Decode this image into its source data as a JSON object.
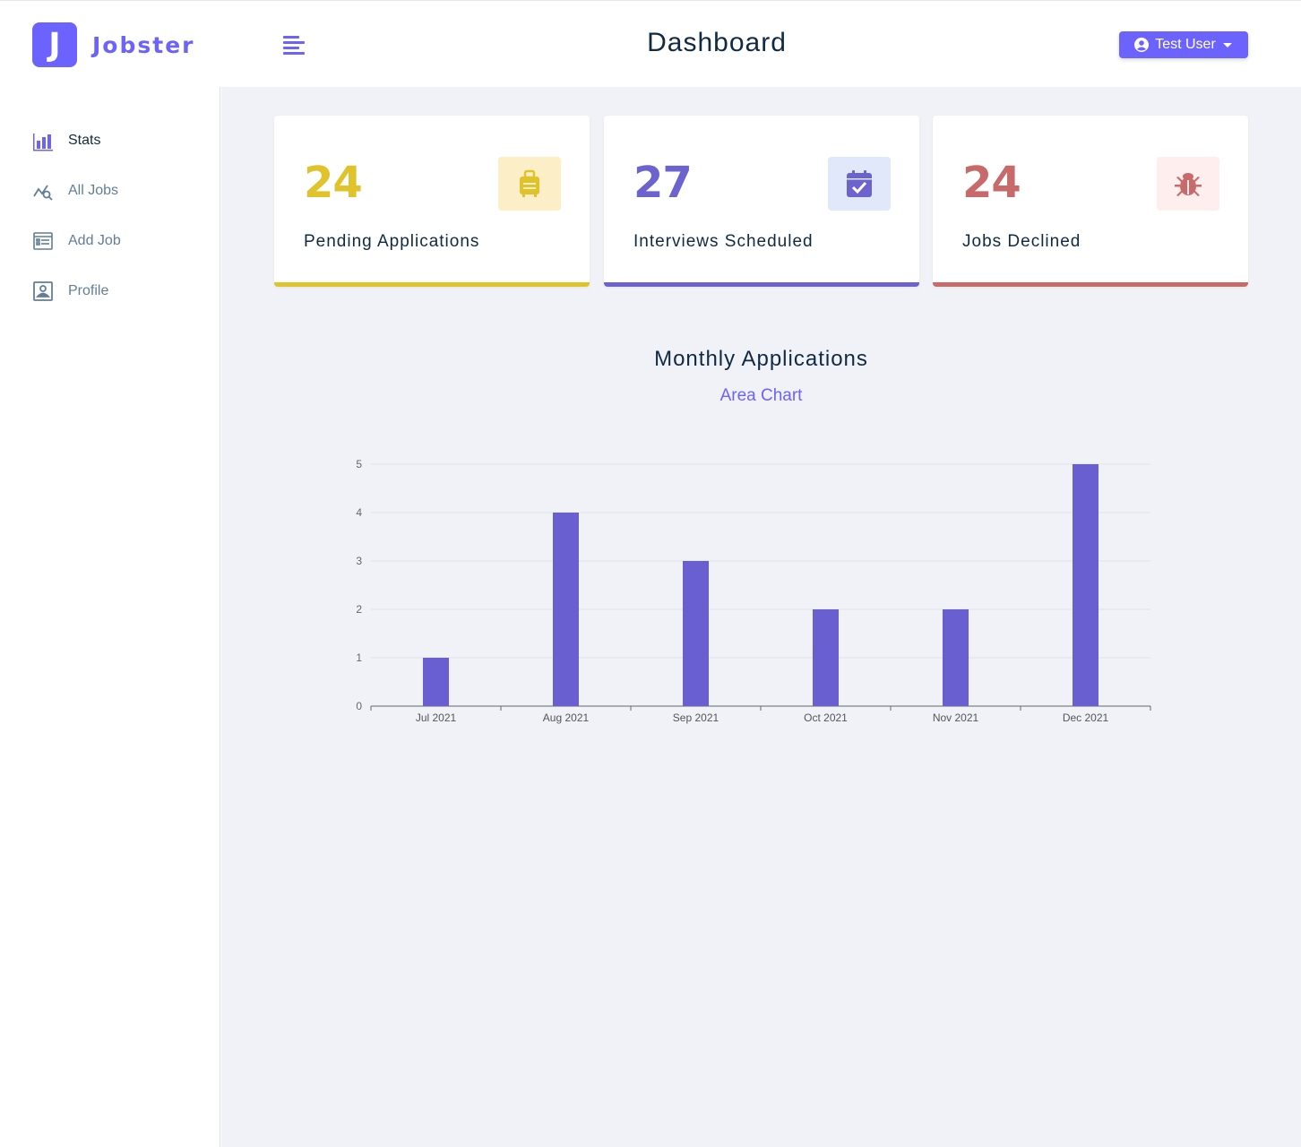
{
  "app": {
    "logo_letter": "J",
    "name": "Jobster"
  },
  "header": {
    "title": "Dashboard",
    "user_label": "Test User"
  },
  "sidebar": {
    "items": [
      {
        "label": "Stats",
        "icon": "bar-chart-icon",
        "active": true
      },
      {
        "label": "All Jobs",
        "icon": "chart-search-icon",
        "active": false
      },
      {
        "label": "Add Job",
        "icon": "form-icon",
        "active": false
      },
      {
        "label": "Profile",
        "icon": "id-badge-icon",
        "active": false
      }
    ]
  },
  "stats": [
    {
      "count": "24",
      "label": "Pending Applications",
      "icon": "suitcase-icon",
      "color": "#e0c22a",
      "bg": "#fcefc7"
    },
    {
      "count": "27",
      "label": "Interviews Scheduled",
      "icon": "calendar-check-icon",
      "color": "#6c63cf",
      "bg": "#e0e8f9"
    },
    {
      "count": "24",
      "label": "Jobs Declined",
      "icon": "bug-icon",
      "color": "#c96a6a",
      "bg": "#ffeeee"
    }
  ],
  "chart_section": {
    "title": "Monthly Applications",
    "toggle_label": "Area Chart"
  },
  "colors": {
    "accent": "#6c63ff",
    "bar": "#6a5fd0"
  },
  "chart_data": {
    "type": "bar",
    "categories": [
      "Jul 2021",
      "Aug 2021",
      "Sep 2021",
      "Oct 2021",
      "Nov 2021",
      "Dec 2021"
    ],
    "values": [
      1,
      4,
      3,
      2,
      2,
      5
    ],
    "yticks": [
      0,
      1,
      2,
      3,
      4,
      5
    ],
    "ylim": [
      0,
      5
    ],
    "grid": true
  }
}
